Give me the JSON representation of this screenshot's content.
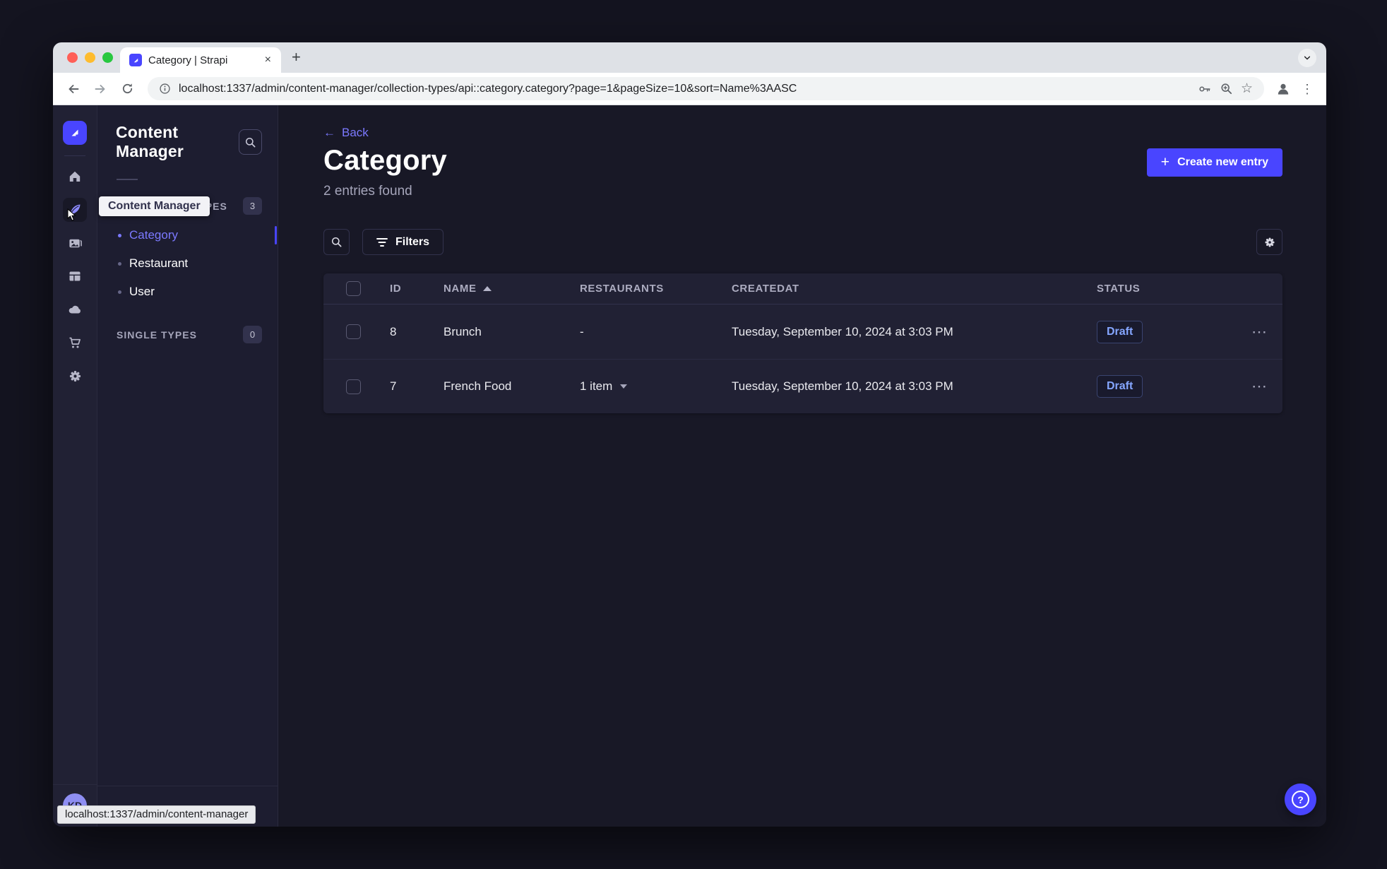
{
  "window": {
    "tab_title": "Category | Strapi",
    "url": "localhost:1337/admin/content-manager/collection-types/api::category.category?page=1&pageSize=10&sort=Name%3AASC",
    "status_bar_url": "localhost:1337/admin/content-manager",
    "new_tab_glyph": "+",
    "close_glyph": "×",
    "kebab_glyph": "⋮"
  },
  "nav_rail": {
    "icon_names": [
      "strapi-logo",
      "home-icon",
      "content-manager-icon",
      "media-library-icon",
      "content-type-builder-icon",
      "cloud-icon",
      "marketplace-icon",
      "settings-icon"
    ],
    "user_initials": "KD",
    "tooltip": "Content Manager"
  },
  "subnav": {
    "title": "Content Manager",
    "sections": [
      {
        "label": "COLLECTION TYPES",
        "count": "3",
        "items": [
          {
            "label": "Category",
            "active": true
          },
          {
            "label": "Restaurant",
            "active": false
          },
          {
            "label": "User",
            "active": false
          }
        ]
      },
      {
        "label": "SINGLE TYPES",
        "count": "0",
        "items": []
      }
    ]
  },
  "content": {
    "back_label": "Back",
    "back_arrow": "←",
    "title": "Category",
    "subtitle": "2 entries found",
    "create_button_label": "Create new entry",
    "filters_button_label": "Filters",
    "table": {
      "headers": {
        "id": "ID",
        "name": "NAME",
        "restaurants": "RESTAURANTS",
        "createdat": "CREATEDAT",
        "status": "STATUS"
      },
      "sort": {
        "column": "NAME",
        "direction": "asc"
      },
      "rows": [
        {
          "id": "8",
          "name": "Brunch",
          "restaurants": "-",
          "createdat": "Tuesday, September 10, 2024 at 3:03 PM",
          "status": "Draft"
        },
        {
          "id": "7",
          "name": "French Food",
          "restaurants": "1 item",
          "createdat": "Tuesday, September 10, 2024 at 3:03 PM",
          "status": "Draft"
        }
      ],
      "row_menu_glyph": "⋯"
    },
    "help_glyph": "?"
  },
  "colors": {
    "primary": "#4945ff",
    "link": "#7b79ff",
    "page_bg": "#181826",
    "surface": "#212134",
    "border": "#32324d",
    "draft_text": "#85a6ff",
    "traffic_red": "#ff5f57",
    "traffic_yellow": "#febc2e",
    "traffic_green": "#28c840"
  }
}
